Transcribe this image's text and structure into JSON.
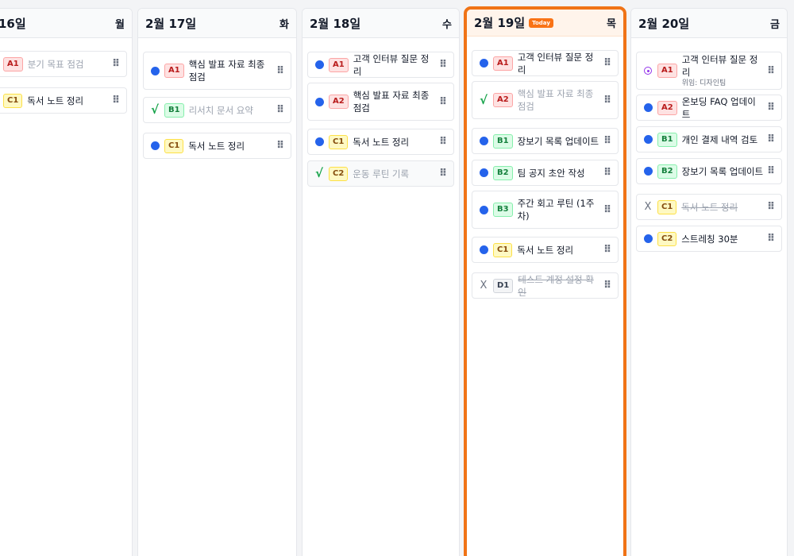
{
  "columns": [
    {
      "date": "16일",
      "dow": "월",
      "today": false,
      "cards": [
        {
          "mark": "none",
          "tag": "A1",
          "text": "분기 목표 점검",
          "style": "muted"
        },
        {
          "mark": "none",
          "tag": "C1",
          "text": "독서 노트 정리",
          "style": "normal"
        }
      ]
    },
    {
      "date": "2월 17일",
      "dow": "화",
      "today": false,
      "cards": [
        {
          "mark": "dot",
          "tag": "A1",
          "text": "핵심 발표 자료 최종 점검",
          "style": "normal"
        },
        {
          "mark": "check",
          "tag": "B1",
          "text": "리서치 문서 요약",
          "style": "muted"
        },
        {
          "mark": "dot",
          "tag": "C1",
          "text": "독서 노트 정리",
          "style": "normal"
        }
      ]
    },
    {
      "date": "2월 18일",
      "dow": "수",
      "today": false,
      "cards": [
        {
          "mark": "dot",
          "tag": "A1",
          "text": "고객 인터뷰 질문 정리",
          "style": "normal"
        },
        {
          "mark": "dot",
          "tag": "A2",
          "text": "핵심 발표 자료 최종 점검",
          "style": "normal"
        },
        {
          "mark": "dot",
          "tag": "C1",
          "text": "독서 노트 정리",
          "style": "normal"
        },
        {
          "mark": "check",
          "tag": "C2",
          "text": "운동 루틴 기록",
          "style": "muted"
        }
      ]
    },
    {
      "date": "2월 19일",
      "dow": "목",
      "today": true,
      "badge": "Today",
      "cards": [
        {
          "mark": "dot",
          "tag": "A1",
          "text": "고객 인터뷰 질문 정리",
          "style": "normal"
        },
        {
          "mark": "check",
          "tag": "A2",
          "text": "핵심 발표 자료 최종 점검",
          "style": "muted"
        },
        {
          "mark": "dot",
          "tag": "B1",
          "text": "장보기 목록 업데이트",
          "style": "normal"
        },
        {
          "mark": "dot",
          "tag": "B2",
          "text": "팀 공지 초안 작성",
          "style": "normal"
        },
        {
          "mark": "dot",
          "tag": "B3",
          "text": "주간 회고 루틴 (1주차)",
          "style": "normal"
        },
        {
          "mark": "dot",
          "tag": "C1",
          "text": "독서 노트 정리",
          "style": "normal"
        },
        {
          "mark": "x",
          "tag": "D1",
          "text": "테스트 계정 설정 확인",
          "style": "strike"
        }
      ]
    },
    {
      "date": "2월 20일",
      "dow": "금",
      "today": false,
      "cards": [
        {
          "mark": "ring",
          "tag": "A1",
          "text": "고객 인터뷰 질문 정리",
          "sub": "위임: 디자인팀",
          "style": "normal"
        },
        {
          "mark": "dot",
          "tag": "A2",
          "text": "온보딩 FAQ 업데이트",
          "style": "normal"
        },
        {
          "mark": "dot",
          "tag": "B1",
          "text": "개인 결제 내역 검토",
          "style": "normal"
        },
        {
          "mark": "dot",
          "tag": "B2",
          "text": "장보기 목록 업데이트",
          "style": "normal"
        },
        {
          "mark": "x",
          "tag": "C1",
          "text": "독서 노트 정리",
          "style": "strike"
        },
        {
          "mark": "dot",
          "tag": "C2",
          "text": "스트레칭 30분",
          "style": "normal"
        }
      ]
    }
  ]
}
